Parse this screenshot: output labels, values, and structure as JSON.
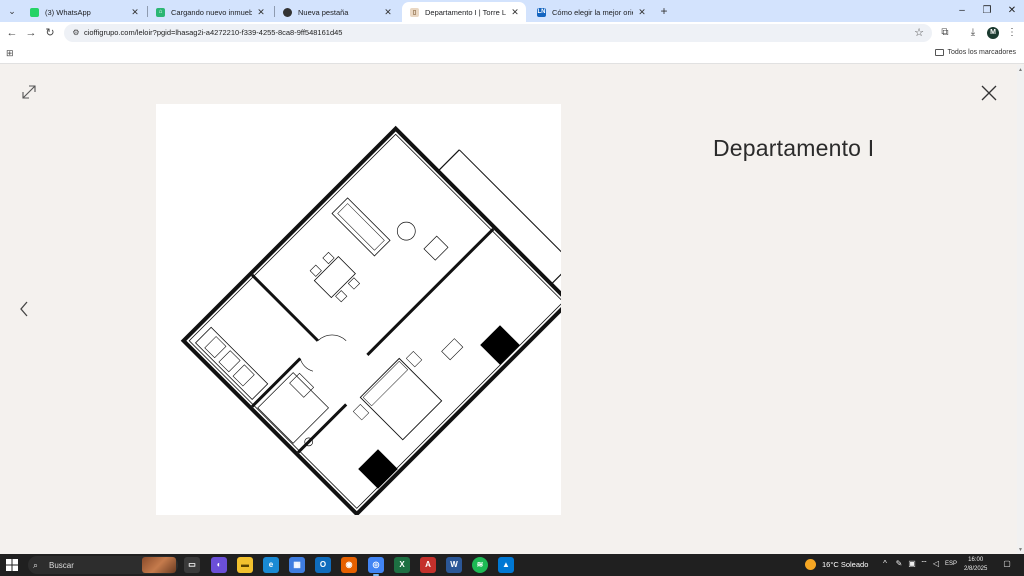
{
  "browser": {
    "tabs": [
      {
        "title": "(3) WhatsApp",
        "favicon": "whatsapp-icon",
        "color": "#25d366",
        "active": false
      },
      {
        "title": "Cargando nuevo inmueble - ICB",
        "favicon": "house-icon",
        "color": "#2bb673",
        "active": false
      },
      {
        "title": "Nueva pestaña",
        "favicon": "globe-icon",
        "color": "#333333",
        "active": false
      },
      {
        "title": "Departamento I | Torre Leloir",
        "favicon": "page-icon",
        "color": "#c7a27a",
        "active": true
      },
      {
        "title": "Cómo elegir la mejor orientació",
        "favicon": "ln-icon",
        "color": "#1565c0",
        "active": false
      }
    ],
    "new_tab": "+",
    "window_controls": {
      "minimize": "–",
      "restore": "❐",
      "close": "✕"
    },
    "url": "cioffigrupo.com/leloir?pgid=lhasag2i-a4272210-f339-4255-8ca8-9ff548161d45",
    "profile_initial": "M",
    "bookmarks_label": "Todos los marcadores"
  },
  "page": {
    "title": "Departamento I",
    "image_alt": "floor-plan"
  },
  "taskbar": {
    "search_placeholder": "Buscar",
    "weather": "16°C  Soleado",
    "language": "ESP",
    "time": "16:00",
    "date": "2/8/2025",
    "apps": [
      {
        "name": "task-view",
        "color": "#3a3a3a",
        "glyph": "▭"
      },
      {
        "name": "copilot",
        "color": "#6b4fd8",
        "glyph": "◐"
      },
      {
        "name": "file-explorer",
        "color": "#f2c12e",
        "glyph": "▬"
      },
      {
        "name": "edge",
        "color": "#1a8ad4",
        "glyph": "e"
      },
      {
        "name": "store",
        "color": "#3f7de0",
        "glyph": "▦"
      },
      {
        "name": "outlook",
        "color": "#0f6cbd",
        "glyph": "O"
      },
      {
        "name": "firefox",
        "color": "#e66000",
        "glyph": "◉"
      },
      {
        "name": "chrome",
        "color": "#4285f4",
        "glyph": "◎"
      },
      {
        "name": "excel",
        "color": "#1d6f42",
        "glyph": "X"
      },
      {
        "name": "acrobat",
        "color": "#c4302b",
        "glyph": "A"
      },
      {
        "name": "word",
        "color": "#2b5797",
        "glyph": "W"
      },
      {
        "name": "spotify",
        "color": "#1db954",
        "glyph": "≋"
      },
      {
        "name": "photos",
        "color": "#0078d4",
        "glyph": "▲"
      }
    ]
  }
}
